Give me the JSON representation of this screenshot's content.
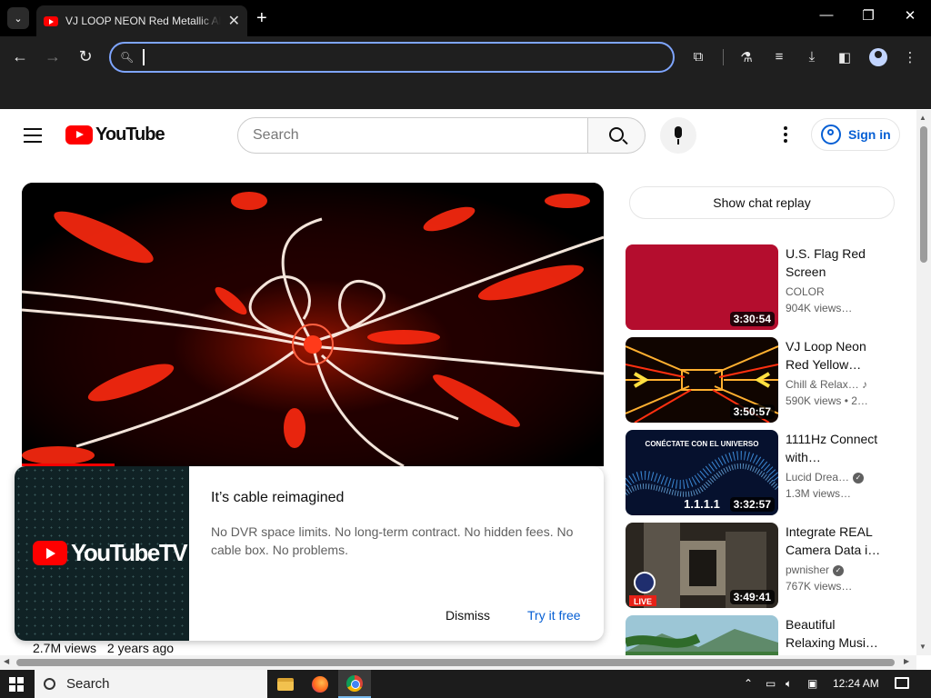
{
  "browser": {
    "tab_title": "VJ LOOP NEON Red Metallic Abstract",
    "tab_close": "✕",
    "new_tab": "+",
    "address_value": "",
    "window_buttons": {
      "minimize": "—",
      "maximize": "❐",
      "close": "✕"
    }
  },
  "youtube": {
    "logo_text": "YouTube",
    "search_placeholder": "Search",
    "sign_in": "Sign in",
    "player": {
      "progress_fraction": 0.16
    },
    "views": "2.7M views",
    "age": "2 years ago",
    "promo": {
      "logo_text": "YouTubeTV",
      "title": "It’s cable reimagined",
      "body": "No DVR space limits. No long-term contract. No hidden fees. No cable box. No problems.",
      "dismiss": "Dismiss",
      "try": "Try it free"
    },
    "chat_replay": "Show chat replay",
    "recommendations": [
      {
        "title": "U.S. Flag Red Screen",
        "channel": "COLOR",
        "meta": "904K views…",
        "duration": "3:30:54"
      },
      {
        "title": "VJ Loop Neon Red Yellow…",
        "channel": "Chill & Relax…",
        "meta": "590K views • 2…",
        "duration": "3:50:57"
      },
      {
        "title": "1111Hz Connect with…",
        "channel": "Lucid Drea…",
        "meta": "1.3M views…",
        "duration": "3:32:57",
        "thumb_text": "CONÉCTATE CON EL UNIVERSO",
        "thumb_number": "1.1.1.1"
      },
      {
        "title": "Integrate REAL Camera Data i…",
        "channel": "pwnisher",
        "meta": "767K views…",
        "duration": "3:49:41",
        "live": "LIVE"
      },
      {
        "title": "Beautiful Relaxing Musi…",
        "channel": "",
        "meta": "",
        "duration": ""
      }
    ]
  },
  "taskbar": {
    "search": "Search",
    "time": "12:24 AM"
  },
  "colors": {
    "accent": "#065fd4",
    "brand_red": "#ff0000",
    "focus_ring": "#7ea5ff"
  }
}
